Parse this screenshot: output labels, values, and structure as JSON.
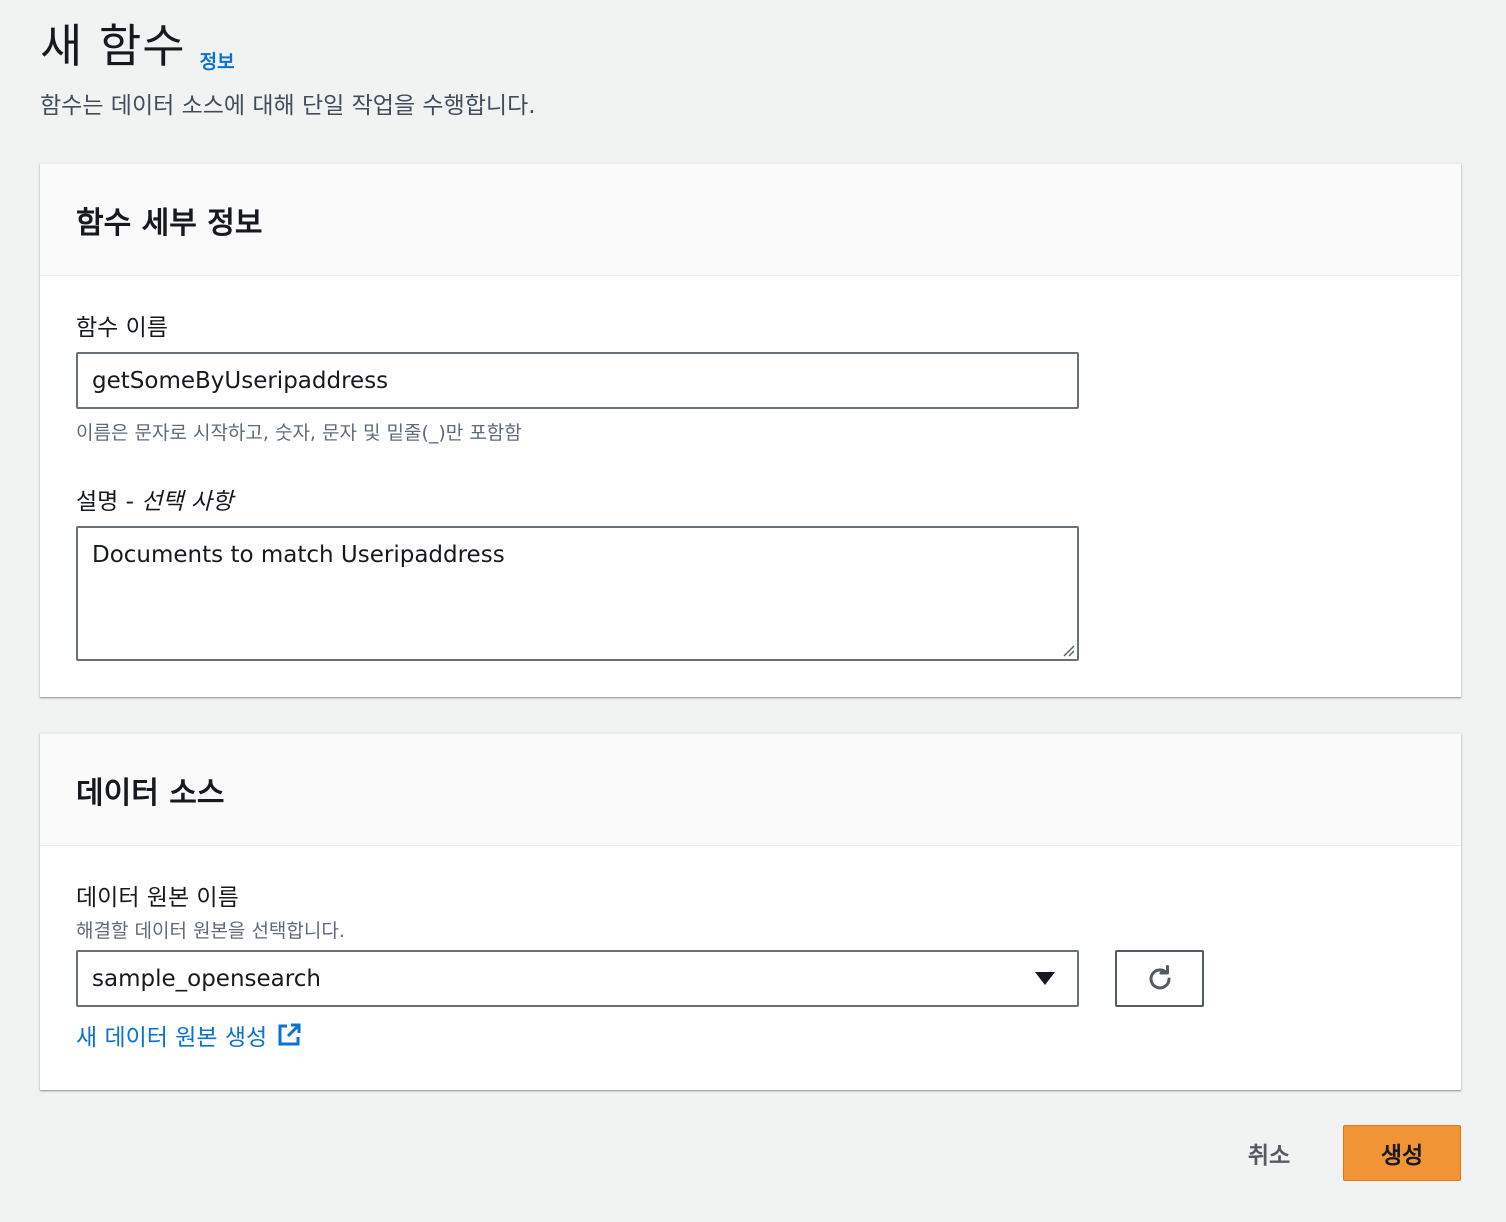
{
  "header": {
    "title": "새 함수",
    "info_link": "정보",
    "description": "함수는 데이터 소스에 대해 단일 작업을 수행합니다."
  },
  "function_details": {
    "panel_title": "함수 세부 정보",
    "name_label": "함수 이름",
    "name_value": "getSomeByUseripaddress",
    "name_constraint": "이름은 문자로 시작하고, 숫자, 문자 및 밑줄(_)만 포함함",
    "description_label": "설명 - ",
    "description_optional": "선택 사항",
    "description_value": "Documents to match Useripaddress"
  },
  "data_source": {
    "panel_title": "데이터 소스",
    "source_label": "데이터 원본 이름",
    "source_hint": "해결할 데이터 원본을 선택합니다.",
    "selected_source": "sample_opensearch",
    "create_link": "새 데이터 원본 생성"
  },
  "actions": {
    "cancel_label": "취소",
    "create_label": "생성"
  },
  "icons": {
    "select_caret": "caret-down-icon",
    "refresh": "refresh-icon",
    "external_link": "external-link-icon",
    "resize": "resize-grip-icon"
  },
  "colors": {
    "link": "#0972d3",
    "primary_button": "#f19436",
    "background": "#f1f2f2"
  }
}
